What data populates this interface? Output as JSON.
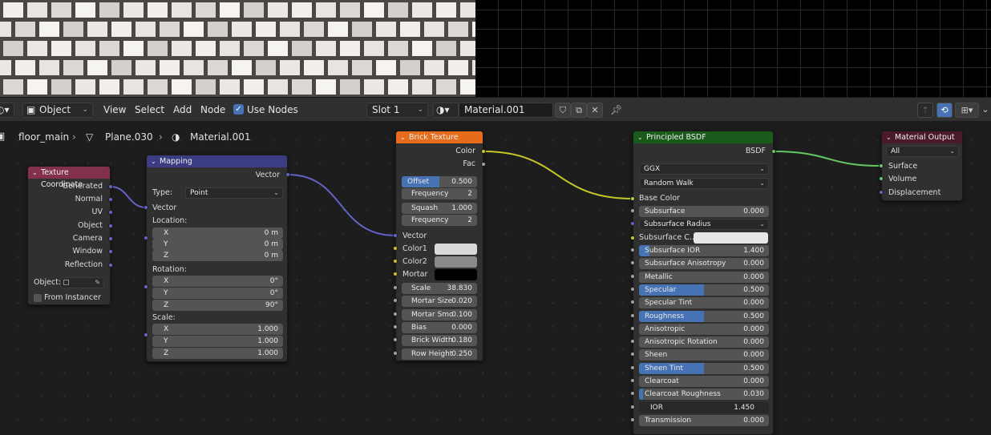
{
  "header": {
    "mode": "Object",
    "menus": [
      "View",
      "Select",
      "Add",
      "Node"
    ],
    "use_nodes": "Use Nodes",
    "slot": "Slot 1",
    "material": "Material.001"
  },
  "breadcrumb": {
    "object": "floor_main",
    "mesh": "Plane.030",
    "material": "Material.001"
  },
  "texcoord": {
    "title": "Texture Coordinate",
    "outputs": [
      "Generated",
      "Normal",
      "UV",
      "Object",
      "Camera",
      "Window",
      "Reflection"
    ],
    "object_label": "Object:",
    "from_instancer": "From Instancer"
  },
  "mapping": {
    "title": "Mapping",
    "output": "Vector",
    "type_label": "Type:",
    "type_value": "Point",
    "vector": "Vector",
    "location": "Location:",
    "rotation": "Rotation:",
    "scale": "Scale:",
    "loc": [
      "0 m",
      "0 m",
      "0 m"
    ],
    "rot": [
      "0°",
      "0°",
      "90°"
    ],
    "scl": [
      "1.000",
      "1.000",
      "1.000"
    ],
    "axes": [
      "X",
      "Y",
      "Z"
    ]
  },
  "brick": {
    "title": "Brick Texture",
    "outputs": [
      "Color",
      "Fac"
    ],
    "offset_label": "Offset",
    "offset": "0.500",
    "offset_frac": 0.5,
    "freq_label": "Frequency",
    "freq1": "2",
    "squash_label": "Squash",
    "squash": "1.000",
    "freq2": "2",
    "vector": "Vector",
    "color1": "Color1",
    "color2": "Color2",
    "mortar": "Mortar",
    "color1_hex": "#d9d9d9",
    "color2_hex": "#8a8a8a",
    "mortar_hex": "#000000",
    "fields": [
      {
        "label": "Scale",
        "value": "38.830"
      },
      {
        "label": "Mortar Size",
        "value": "0.020"
      },
      {
        "label": "Mortar Smo",
        "value": "0.100"
      },
      {
        "label": "Bias",
        "value": "0.000"
      },
      {
        "label": "Brick Width",
        "value": "0.180"
      },
      {
        "label": "Row Height",
        "value": "0.250"
      }
    ]
  },
  "bsdf": {
    "title": "Principled BSDF",
    "output": "BSDF",
    "dist": "GGX",
    "sss_method": "Random Walk",
    "base_color": "Base Color",
    "sss_radius": "Subsurface Radius",
    "sss_color": "Subsurface C...",
    "rows": [
      {
        "label": "Subsurface",
        "value": "0.000",
        "frac": 0
      },
      {
        "label": "Subsurface IOR",
        "value": "1.400",
        "frac": 0.08
      },
      {
        "label": "Subsurface Anisotropy",
        "value": "0.000",
        "frac": 0
      },
      {
        "label": "Metallic",
        "value": "0.000",
        "frac": 0
      },
      {
        "label": "Specular",
        "value": "0.500",
        "frac": 0.5
      },
      {
        "label": "Specular Tint",
        "value": "0.000",
        "frac": 0
      },
      {
        "label": "Roughness",
        "value": "0.500",
        "frac": 0.5
      },
      {
        "label": "Anisotropic",
        "value": "0.000",
        "frac": 0
      },
      {
        "label": "Anisotropic Rotation",
        "value": "0.000",
        "frac": 0
      },
      {
        "label": "Sheen",
        "value": "0.000",
        "frac": 0
      },
      {
        "label": "Sheen Tint",
        "value": "0.500",
        "frac": 0.5
      },
      {
        "label": "Clearcoat",
        "value": "0.000",
        "frac": 0
      },
      {
        "label": "Clearcoat Roughness",
        "value": "0.030",
        "frac": 0.03
      },
      {
        "label": "IOR",
        "value": "1.450",
        "frac": 0
      },
      {
        "label": "Transmission",
        "value": "0.000",
        "frac": 0
      }
    ]
  },
  "output": {
    "title": "Material Output",
    "target": "All",
    "inputs": [
      "Surface",
      "Volume",
      "Displacement"
    ]
  },
  "colors": {
    "texcoord_head": "#83314a",
    "mapping_head": "#3c3c83",
    "brick_head": "#e66c1b",
    "bsdf_head": "#1a5a1a",
    "output_head": "#4a1a28",
    "vector_link": "#6363c7",
    "color_link": "#c7c729",
    "shader_link": "#63c763"
  }
}
